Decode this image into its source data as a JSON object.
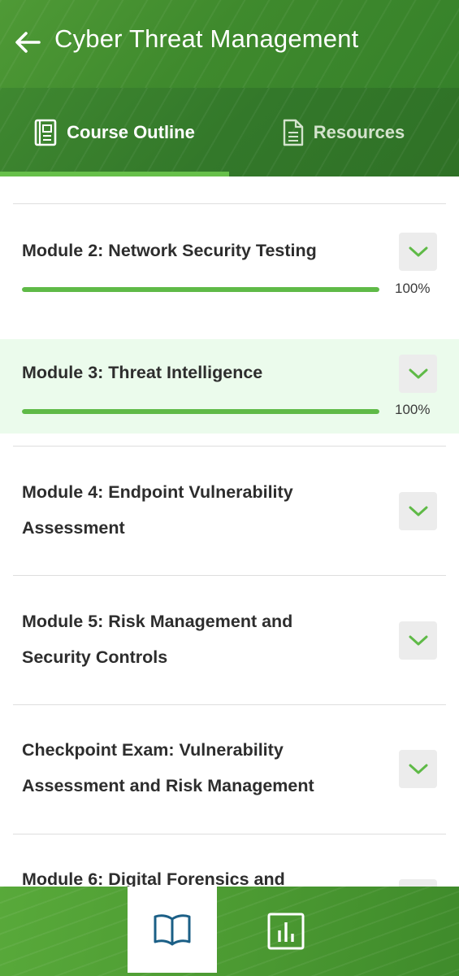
{
  "header": {
    "title": "Cyber Threat Management",
    "back_icon": "arrow-left-icon"
  },
  "tabs": [
    {
      "label": "Course Outline",
      "icon": "outline-icon",
      "active": true
    },
    {
      "label": "Resources",
      "icon": "document-icon",
      "active": false
    }
  ],
  "modules": [
    {
      "title": "Module 2: Network Security Testing",
      "progress_text": "100%",
      "progress": 1.0
    },
    {
      "title": "Module 3: Threat Intelligence",
      "progress_text": "100%",
      "progress": 1.0,
      "highlighted": true
    },
    {
      "title_line1": "Module 4: Endpoint Vulnerability",
      "title_line2": "Assessment"
    },
    {
      "title_line1": "Module 5: Risk Management and",
      "title_line2": "Security Controls"
    },
    {
      "title_line1": "Checkpoint Exam: Vulnerability",
      "title_line2": "Assessment and Risk Management"
    },
    {
      "title_line1": "Module 6: Digital Forensics and"
    }
  ],
  "bottom_nav": [
    {
      "icon": "book-icon",
      "active": true
    },
    {
      "icon": "bar-chart-icon",
      "active": false
    }
  ],
  "colors": {
    "brand_green": "#3f8a2d",
    "accent_green": "#5fba47",
    "highlight_bg": "#ebfbec",
    "nav_active_icon": "#1b5f86"
  }
}
